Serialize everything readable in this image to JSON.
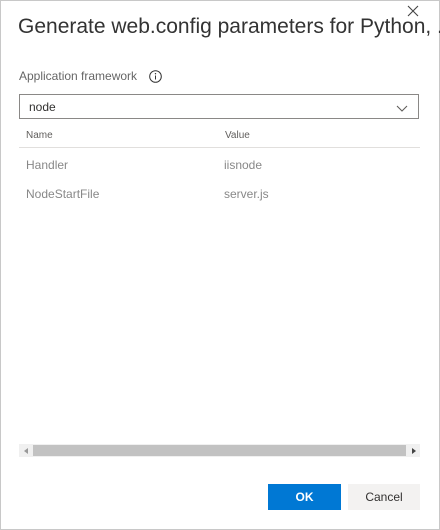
{
  "dialog": {
    "title": "Generate web.config parameters for Python, ..."
  },
  "field": {
    "label": "Application framework",
    "selected_value": "node"
  },
  "grid": {
    "columns": [
      "Name",
      "Value"
    ],
    "rows": [
      {
        "name": "Handler",
        "value": "iisnode"
      },
      {
        "name": "NodeStartFile",
        "value": "server.js"
      }
    ]
  },
  "buttons": {
    "ok": "OK",
    "cancel": "Cancel"
  },
  "colors": {
    "primary": "#0078d4",
    "secondary_button": "#f3f2f1"
  },
  "icons": {
    "close": "close-icon",
    "info": "info-icon",
    "dropdown": "chevron-down-icon",
    "scroll_left": "scroll-left-arrow-icon",
    "scroll_right": "scroll-right-arrow-icon"
  }
}
